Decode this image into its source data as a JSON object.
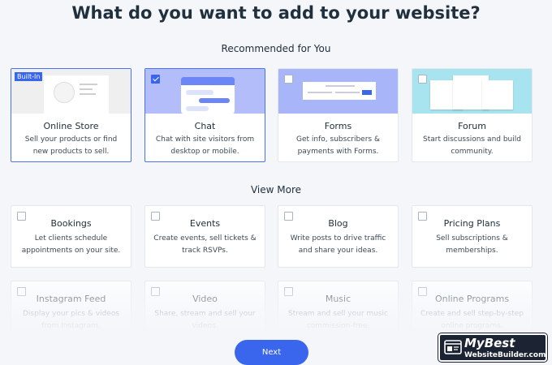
{
  "header": {
    "title": "What do you want to add to your website?"
  },
  "recommended": {
    "label": "Recommended for You",
    "cards": [
      {
        "name": "Online Store",
        "desc1": "Sell your products or find",
        "desc2": "new products to sell.",
        "badge": "Built-In",
        "selected": true
      },
      {
        "name": "Chat",
        "desc1": "Chat with site visitors from",
        "desc2": "desktop or mobile.",
        "checked": true,
        "selected": true
      },
      {
        "name": "Forms",
        "desc1": "Get info, subscribers &",
        "desc2": "payments with Forms.",
        "checked": false
      },
      {
        "name": "Forum",
        "desc1": "Start discussions and build",
        "desc2": "community.",
        "checked": false
      }
    ]
  },
  "more": {
    "label": "View More",
    "cards": [
      {
        "name": "Bookings",
        "desc1": "Let clients schedule",
        "desc2": "appointments on your site."
      },
      {
        "name": "Events",
        "desc1": "Create events, sell tickets &",
        "desc2": "track RSVPs."
      },
      {
        "name": "Blog",
        "desc1": "Write posts to drive traffic",
        "desc2": "and share your ideas."
      },
      {
        "name": "Pricing Plans",
        "desc1": "Sell subscriptions &",
        "desc2": "memberships."
      },
      {
        "name": "Instagram Feed",
        "desc1": "Display your pics & videos",
        "desc2": "from Instagram."
      },
      {
        "name": "Video",
        "desc1": "Share, stream and sell your",
        "desc2": "videos."
      },
      {
        "name": "Music",
        "desc1": "Stream and sell your music",
        "desc2": "commission-free."
      },
      {
        "name": "Online Programs",
        "desc1": "Create and sell step-by-step",
        "desc2": "online programs."
      }
    ]
  },
  "footer": {
    "next_label": "Next"
  },
  "watermark": {
    "line1": "MyBest",
    "line2": "WebsiteBuilder.com"
  },
  "colors": {
    "accent": "#3a66ee",
    "background": "#f4f6fa",
    "text": "#20303c"
  }
}
